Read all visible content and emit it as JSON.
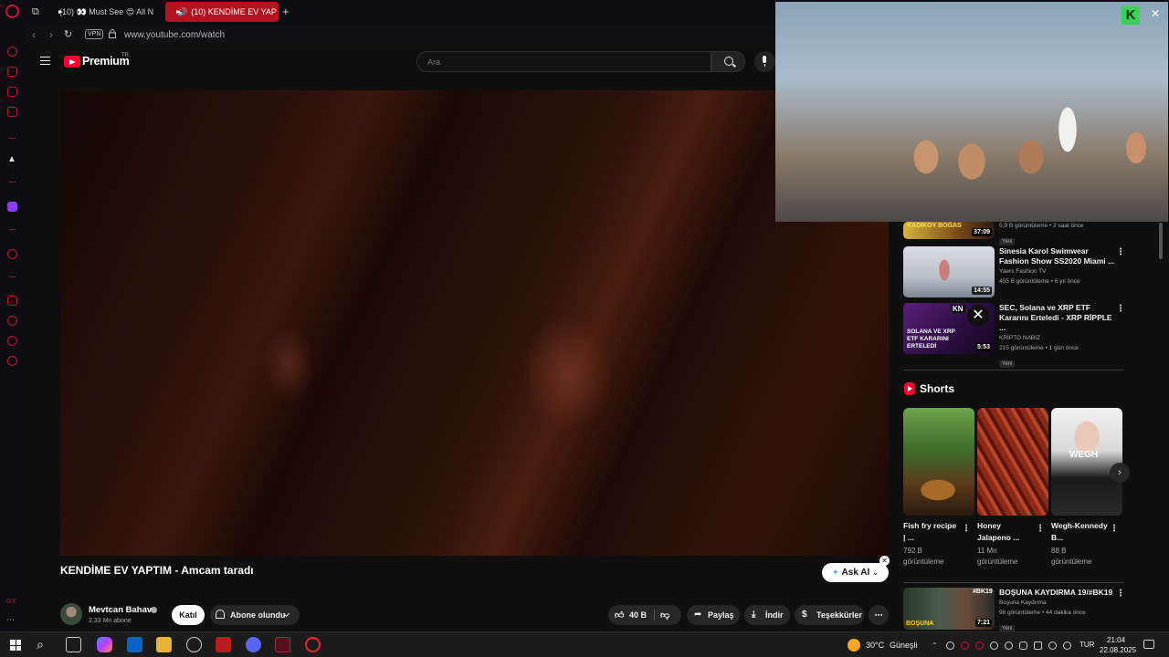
{
  "browser": {
    "tabs": [
      {
        "label": "(10) 👀 Must See 😍 All N"
      },
      {
        "label": "(10) KENDİME EV YAP"
      }
    ],
    "new_tab_symbol": "+",
    "url": "www.youtube.com/watch",
    "vpn_label": "VPN",
    "sidebar_footer": "GX"
  },
  "youtube": {
    "brand": "Premium",
    "region": "TR",
    "search_placeholder": "Ara",
    "video": {
      "title": "KENDİME EV YAPTIM - Amcam taradı",
      "ask_ai": "Ask AI",
      "channel": "Mevtcan Bahav",
      "subscribers": "2,33 Mn abone",
      "join_label": "Katıl",
      "subscribed_label": "Abone olundu",
      "likes": "40 B",
      "share_label": "Paylaş",
      "download_label": "İndir",
      "thanks_label": "Teşekkürler"
    },
    "recommendations": [
      {
        "title": "",
        "thumb_text": "KADIKÖY BOĞAS",
        "duration": "37:09",
        "meta": "5,9 B görüntüleme • 2 saat önce",
        "badge": "Yeni"
      },
      {
        "title": "Sinesia Karol Swimwear Fashion Show SS2020 Miami ...",
        "channel": "Yaers Fashion TV",
        "duration": "14:55",
        "meta": "455 B görüntüleme • 6 yıl önce",
        "badge": ""
      },
      {
        "title": "SEC, Solana ve XRP ETF Kararını Erteledi - XRP RİPPLE ...",
        "channel": "KRİPTO NABIZ",
        "duration": "5:53",
        "thumb_text": "SOLANA VE XRP ETF KARARINI ERTELEDİ",
        "thumb_badge": "KN",
        "meta": "215 görüntüleme • 1 gün önce",
        "badge": "Yeni"
      },
      {
        "title": "BOŞUNA KAYDIRMA 19/#BK19",
        "channel": "Boşuna Kaydırma",
        "duration": "7:21",
        "thumb_text": "#BK19",
        "thumb_text_2": "BOŞUNA",
        "meta": "96 görüntüleme • 44 dakika önce",
        "badge": "Yeni"
      }
    ],
    "shorts_heading": "Shorts",
    "shorts": [
      {
        "title": "Fish fry recipe | ...",
        "views": "792 B görüntüleme"
      },
      {
        "title": "Honey Jalapeno ...",
        "views": "11 Mn görüntüleme"
      },
      {
        "title": "Wegh-Kennedy B...",
        "views": "88 B görüntüleme",
        "thumb_text": "WEGH"
      }
    ]
  },
  "pip": {
    "badge": "K"
  },
  "taskbar": {
    "weather": "30°C",
    "weather_desc": "Güneşli",
    "lang": "TUR",
    "time": "21:04",
    "date": "22.08.2025"
  },
  "colors": {
    "accent": "#d3103b",
    "yt_red": "#ff0033",
    "bg": "#0f0f0f"
  }
}
